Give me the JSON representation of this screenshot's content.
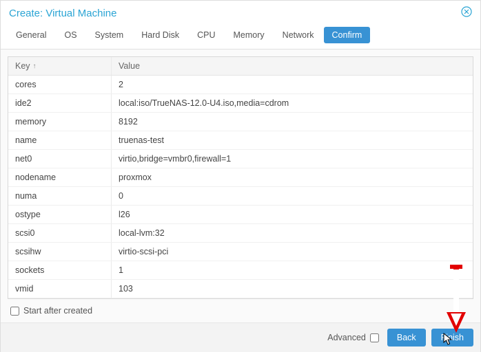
{
  "title": "Create: Virtual Machine",
  "tabs": [
    {
      "label": "General"
    },
    {
      "label": "OS"
    },
    {
      "label": "System"
    },
    {
      "label": "Hard Disk"
    },
    {
      "label": "CPU"
    },
    {
      "label": "Memory"
    },
    {
      "label": "Network"
    },
    {
      "label": "Confirm",
      "active": true
    }
  ],
  "columns": {
    "key": "Key",
    "value": "Value"
  },
  "rows": [
    {
      "k": "cores",
      "v": "2"
    },
    {
      "k": "ide2",
      "v": "local:iso/TrueNAS-12.0-U4.iso,media=cdrom"
    },
    {
      "k": "memory",
      "v": "8192"
    },
    {
      "k": "name",
      "v": "truenas-test"
    },
    {
      "k": "net0",
      "v": "virtio,bridge=vmbr0,firewall=1"
    },
    {
      "k": "nodename",
      "v": "proxmox"
    },
    {
      "k": "numa",
      "v": "0"
    },
    {
      "k": "ostype",
      "v": "l26"
    },
    {
      "k": "scsi0",
      "v": "local-lvm:32"
    },
    {
      "k": "scsihw",
      "v": "virtio-scsi-pci"
    },
    {
      "k": "sockets",
      "v": "1"
    },
    {
      "k": "vmid",
      "v": "103"
    }
  ],
  "start_after_label": "Start after created",
  "advanced_label": "Advanced",
  "back_label": "Back",
  "finish_label": "Finish"
}
